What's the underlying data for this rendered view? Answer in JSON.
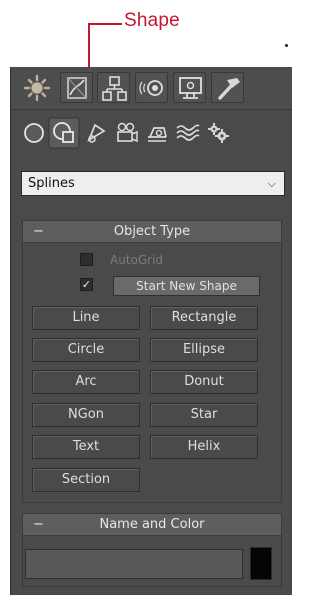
{
  "callout": {
    "label": "Shape",
    "color": "#c3172e"
  },
  "command_panel": {
    "tabs": [
      {
        "name": "create-tab-icon"
      },
      {
        "name": "modify-tab-icon"
      },
      {
        "name": "hierarchy-tab-icon"
      },
      {
        "name": "motion-tab-icon"
      },
      {
        "name": "display-tab-icon"
      },
      {
        "name": "utilities-tab-icon"
      }
    ],
    "categories": [
      {
        "name": "geometry-icon"
      },
      {
        "name": "shapes-icon"
      },
      {
        "name": "lights-icon"
      },
      {
        "name": "cameras-icon"
      },
      {
        "name": "helpers-icon"
      },
      {
        "name": "space-warps-icon"
      },
      {
        "name": "systems-icon"
      }
    ],
    "subcategory_dropdown": {
      "value": "Splines"
    }
  },
  "object_type": {
    "title": "Object Type",
    "collapse_symbol": "−",
    "autogrid_label": "AutoGrid",
    "autogrid_checked": false,
    "start_new_shape_checked": true,
    "start_new_shape_label": "Start New Shape",
    "buttons": [
      "Line",
      "Rectangle",
      "Circle",
      "Ellipse",
      "Arc",
      "Donut",
      "NGon",
      "Star",
      "Text",
      "Helix",
      "Section"
    ]
  },
  "name_and_color": {
    "title": "Name and Color",
    "collapse_symbol": "−",
    "name_value": "",
    "swatch_color": "#050505"
  }
}
